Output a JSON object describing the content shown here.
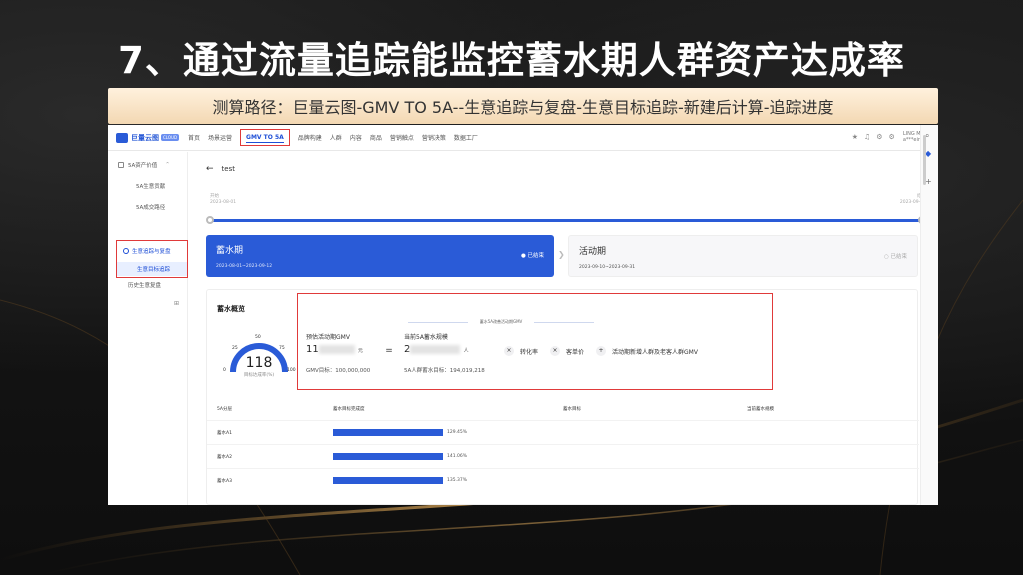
{
  "slide": {
    "title": "7、通过流量追踪能监控蓄水期人群资产达成率",
    "route": "测算路径：巨量云图-GMV TO 5A--生意追踪与复盘-生意目标追踪-新建后计算-追踪进度"
  },
  "colors": {
    "accent_blue": "#2a5bd7",
    "highlight_red": "#e03a3a",
    "route_bar": "#f6dfbe"
  },
  "app": {
    "logo_text": "巨量云图",
    "logo_badge": "CLOUD",
    "nav": [
      "首页",
      "场景运营",
      "GMV TO 5A",
      "品牌构建",
      "人群",
      "内容",
      "商品",
      "营销触点",
      "营销决策",
      "数据工厂"
    ],
    "nav_active_index": 2,
    "nav_icons": [
      "star-icon",
      "bell-icon",
      "message-icon",
      "settings-icon"
    ],
    "user_line1": "LING MEI...",
    "user_line2": "a***ein..."
  },
  "sidebar": {
    "group_label": "5A资产价值",
    "items": [
      "5A生意贡献",
      "5A成交路径"
    ],
    "highlight_group": "生意追踪与复盘",
    "highlight_item": "生意目标追踪",
    "last_item": "历史生意复盘",
    "grid_glyph": "⊞"
  },
  "page": {
    "back_title": "test",
    "timeline_start_label": "开始",
    "timeline_start_date": "2023-08-01",
    "timeline_end_label": "结束",
    "timeline_end_date": "2023-09-31"
  },
  "phases": [
    {
      "name": "蓄水期",
      "date": "2023-08-01~2023-09-12",
      "status": "● 已结束"
    },
    {
      "name": "活动期",
      "date": "2023-09-10~2023-09-31",
      "status": "○ 已结束"
    }
  ],
  "overview": {
    "title": "蓄水概览",
    "gauge": {
      "value": "118",
      "sublabel": "目标达成率(%)",
      "ticks": [
        "0",
        "25",
        "50",
        "75",
        "100"
      ],
      "fill_fraction": 1.0
    },
    "formula": {
      "header": "蓄水5A改善活动期GMV",
      "left_label": "预估活动期GMV",
      "left_value_prefix": "11",
      "left_unit": "元",
      "left_sub": "GMV目标：100,000,000",
      "equals": "=",
      "right_label": "当前5A蓄水规模",
      "right_value_prefix": "2",
      "right_unit": "人",
      "right_sub": "5A人群蓄水目标：194,019,218",
      "terms": [
        "转化率",
        "客单价",
        "活动期新增人群及老客人群GMV"
      ],
      "ops": [
        "×",
        "×",
        "+"
      ]
    },
    "table": {
      "headers": [
        "5A分层",
        "蓄水目标完成度",
        "蓄水目标",
        "当前蓄水规模"
      ],
      "rows": [
        {
          "name": "蓄水A1",
          "pct_label": "129.45%",
          "fill": 1.0
        },
        {
          "name": "蓄水A2",
          "pct_label": "141.06%",
          "fill": 1.0
        },
        {
          "name": "蓄水A3",
          "pct_label": "135.37%",
          "fill": 1.0
        }
      ]
    }
  }
}
